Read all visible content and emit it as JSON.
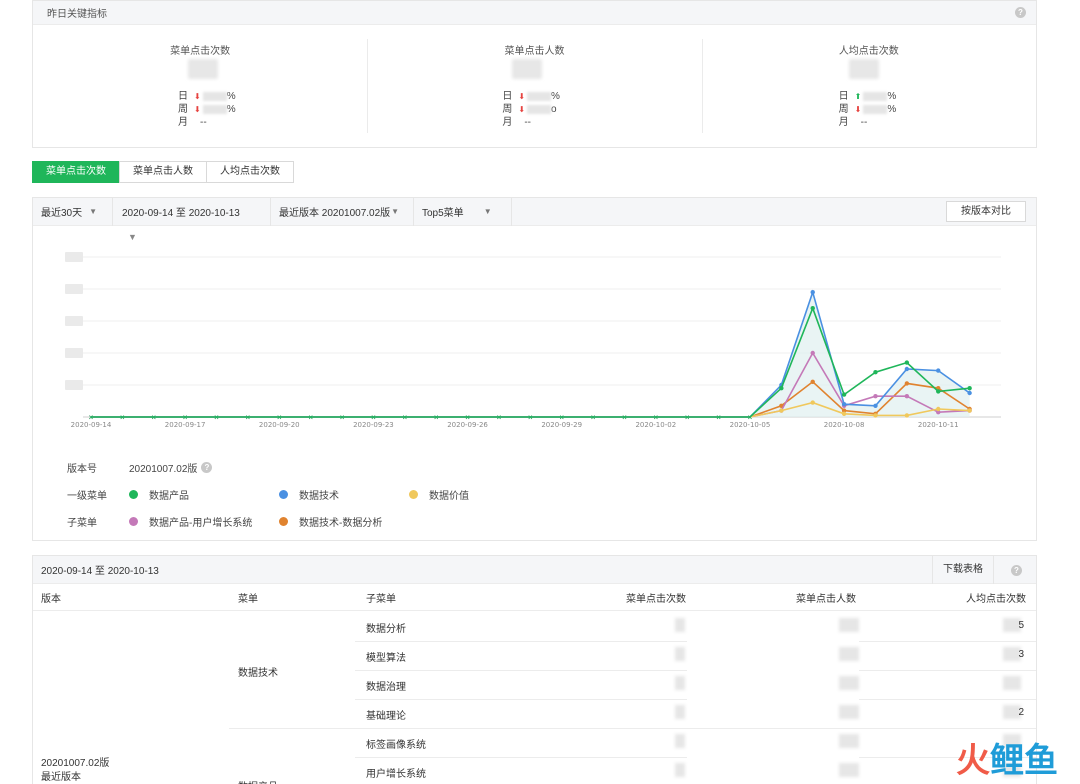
{
  "kpi": {
    "title": "昨日关键指标",
    "cards": [
      {
        "label": "菜单点击次数",
        "day_label": "日",
        "week_label": "周",
        "month_label": "月",
        "day_trend": "down",
        "week_trend": "down",
        "day_pct": "%",
        "week_pct": "%",
        "month_value": "--"
      },
      {
        "label": "菜单点击人数",
        "day_label": "日",
        "week_label": "周",
        "month_label": "月",
        "day_trend": "down",
        "week_trend": "down",
        "day_pct": "%",
        "week_pct": "o",
        "month_value": "--"
      },
      {
        "label": "人均点击次数",
        "day_label": "日",
        "week_label": "周",
        "month_label": "月",
        "day_trend": "up",
        "week_trend": "down",
        "day_pct": "%",
        "week_pct": "%",
        "month_value": "--"
      }
    ]
  },
  "tabs": [
    {
      "label": "菜单点击次数",
      "active": true
    },
    {
      "label": "菜单点击人数",
      "active": false
    },
    {
      "label": "人均点击次数",
      "active": false
    }
  ],
  "filters": {
    "period": "最近30天",
    "date_range": "2020-09-14 至 2020-10-13",
    "version": "最近版本 20201007.02版",
    "menu": "Top5菜单",
    "compare_button": "按版本对比"
  },
  "legend": {
    "version_key": "版本号",
    "version_value": "20201007.02版",
    "level1_key": "一级菜单",
    "sub_key": "子菜单",
    "level1_items": [
      {
        "name": "数据产品",
        "color": "#1fb65a"
      },
      {
        "name": "数据技术",
        "color": "#4a90e2"
      },
      {
        "name": "数据价值",
        "color": "#f0c85c"
      }
    ],
    "sub_items": [
      {
        "name": "数据产品-用户增长系统",
        "color": "#c479b8"
      },
      {
        "name": "数据技术-数据分析",
        "color": "#e0832f"
      }
    ]
  },
  "chart_data": {
    "type": "line",
    "x": [
      "2020-09-14",
      "2020-09-15",
      "2020-09-16",
      "2020-09-17",
      "2020-09-18",
      "2020-09-19",
      "2020-09-20",
      "2020-09-21",
      "2020-09-22",
      "2020-09-23",
      "2020-09-24",
      "2020-09-25",
      "2020-09-26",
      "2020-09-27",
      "2020-09-28",
      "2020-09-29",
      "2020-09-30",
      "2020-10-01",
      "2020-10-02",
      "2020-10-03",
      "2020-10-04",
      "2020-10-05",
      "2020-10-06",
      "2020-10-07",
      "2020-10-08",
      "2020-10-09",
      "2020-10-10",
      "2020-10-11",
      "2020-10-12",
      "2020-10-13"
    ],
    "x_ticks": [
      "2020-09-14",
      "2020-09-17",
      "2020-09-20",
      "2020-09-23",
      "2020-09-26",
      "2020-09-29",
      "2020-10-02",
      "2020-10-05",
      "2020-10-08",
      "2020-10-11"
    ],
    "ylim": [
      0,
      5
    ],
    "y_gridlines": 5,
    "grid": true,
    "legend_position": "bottom-left",
    "series": [
      {
        "name": "数据产品",
        "color": "#1fb65a",
        "values": [
          0,
          0,
          0,
          0,
          0,
          0,
          0,
          0,
          0,
          0,
          0,
          0,
          0,
          0,
          0,
          0,
          0,
          0,
          0,
          0,
          0,
          0,
          0.9,
          3.4,
          0.7,
          1.4,
          1.7,
          0.8,
          0.9
        ]
      },
      {
        "name": "数据技术",
        "color": "#4a90e2",
        "values": [
          0,
          0,
          0,
          0,
          0,
          0,
          0,
          0,
          0,
          0,
          0,
          0,
          0,
          0,
          0,
          0,
          0,
          0,
          0,
          0,
          0,
          0,
          1.0,
          3.9,
          0.4,
          0.35,
          1.5,
          1.45,
          0.75
        ]
      },
      {
        "name": "数据价值",
        "color": "#f0c85c",
        "values": [
          0,
          0,
          0,
          0,
          0,
          0,
          0,
          0,
          0,
          0,
          0,
          0,
          0,
          0,
          0,
          0,
          0,
          0,
          0,
          0,
          0,
          0,
          0.2,
          0.45,
          0.1,
          0.05,
          0.05,
          0.25,
          0.2
        ]
      },
      {
        "name": "数据产品-用户增长系统",
        "color": "#c479b8",
        "values": [
          0,
          0,
          0,
          0,
          0,
          0,
          0,
          0,
          0,
          0,
          0,
          0,
          0,
          0,
          0,
          0,
          0,
          0,
          0,
          0,
          0,
          0,
          0.2,
          2.0,
          0.35,
          0.65,
          0.65,
          0.15,
          0.2
        ]
      },
      {
        "name": "数据技术-数据分析",
        "color": "#e0832f",
        "values": [
          0,
          0,
          0,
          0,
          0,
          0,
          0,
          0,
          0,
          0,
          0,
          0,
          0,
          0,
          0,
          0,
          0,
          0,
          0,
          0,
          0,
          0,
          0.35,
          1.1,
          0.2,
          0.1,
          1.05,
          0.9,
          0.25
        ]
      }
    ]
  },
  "table": {
    "date_range": "2020-09-14 至 2020-10-13",
    "download": "下载表格",
    "headers": [
      "版本",
      "菜单",
      "子菜单",
      "菜单点击次数",
      "菜单点击人数",
      "人均点击次数"
    ],
    "version": "20201007.02版",
    "version_note": "最近版本",
    "groups": [
      {
        "menu": "数据技术",
        "subs": [
          "数据分析",
          "模型算法",
          "数据治理",
          "基础理论"
        ]
      },
      {
        "menu": "数据产品",
        "subs": [
          "标签画像系统",
          "用户增长系统"
        ]
      }
    ],
    "partial_values": [
      "5",
      "3",
      "",
      "2",
      "",
      ""
    ]
  },
  "watermark": {
    "part1": "火",
    "part2": "鲤鱼"
  }
}
